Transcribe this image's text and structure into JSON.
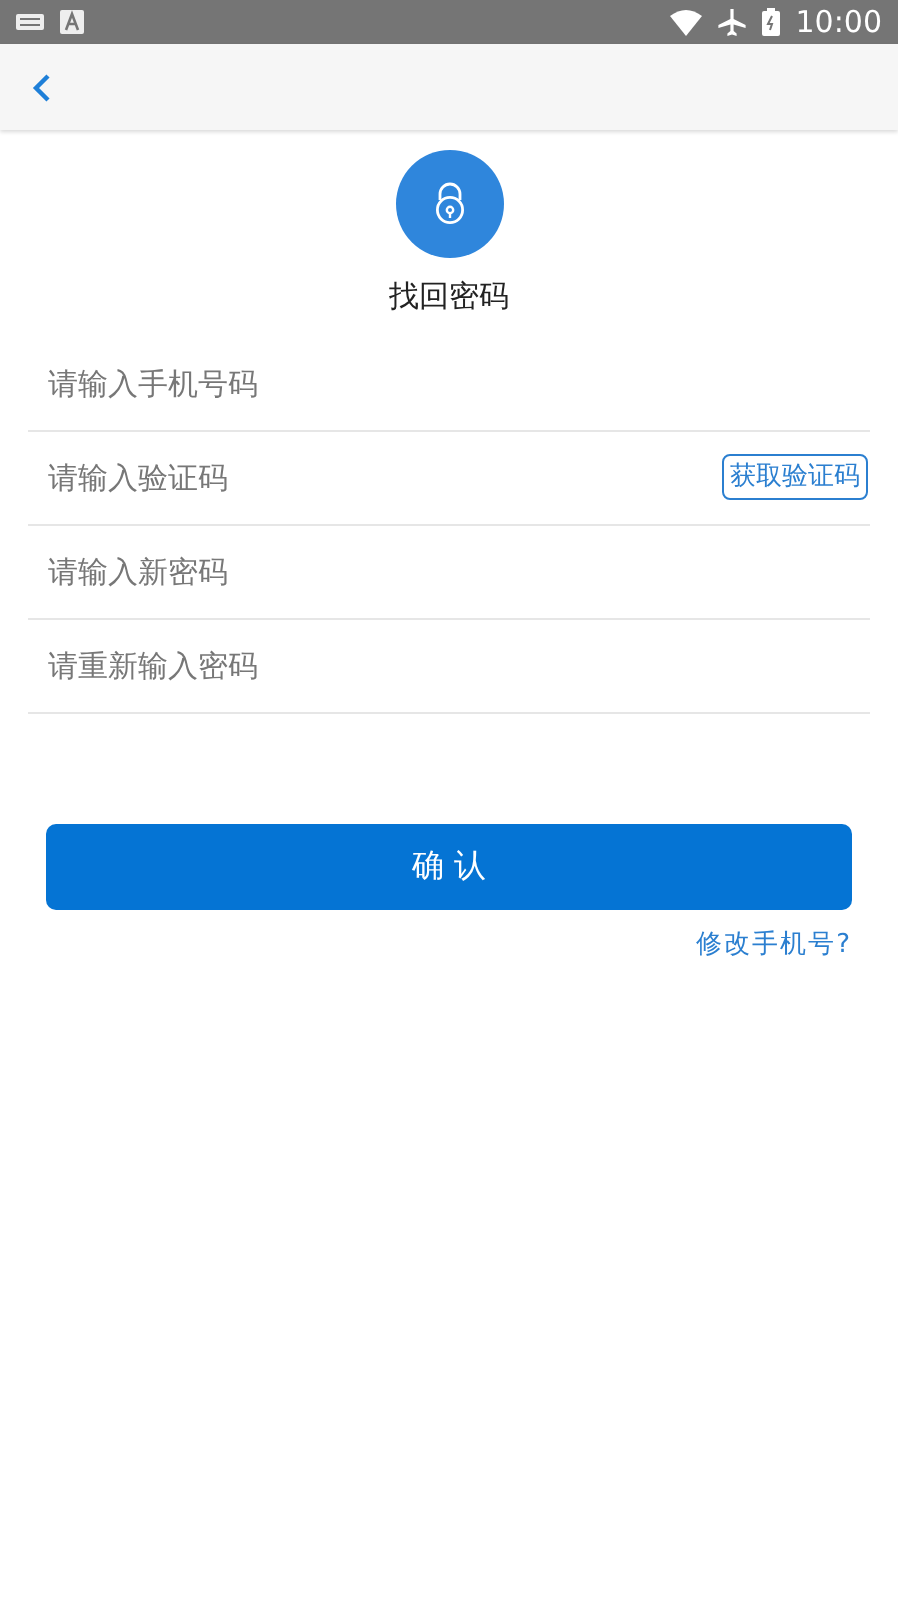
{
  "status_bar": {
    "time": "10:00"
  },
  "header": {
    "title": "找回密码"
  },
  "fields": [
    {
      "placeholder": "请输入手机号码"
    },
    {
      "placeholder": "请输入验证码",
      "action": "获取验证码"
    },
    {
      "placeholder": "请输入新密码"
    },
    {
      "placeholder": "请重新输入密码"
    }
  ],
  "confirm_button": "确 认",
  "change_phone_link": "修改手机号?"
}
